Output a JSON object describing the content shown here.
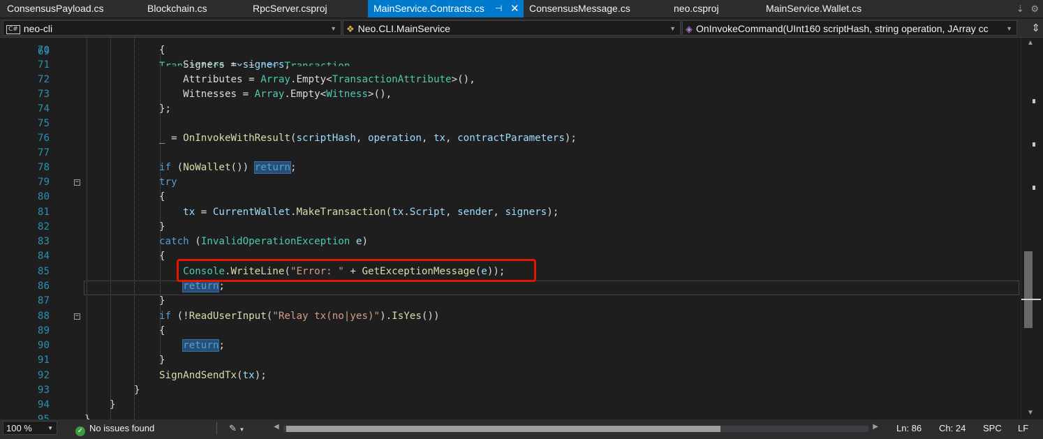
{
  "tabs": [
    {
      "label": "ConsensusPayload.cs"
    },
    {
      "label": "Blockchain.cs"
    },
    {
      "label": "RpcServer.csproj"
    },
    {
      "label": "MainService.Contracts.cs",
      "active": true
    },
    {
      "label": "ConsensusMessage.cs"
    },
    {
      "label": "neo.csproj"
    },
    {
      "label": "MainService.Wallet.cs"
    }
  ],
  "tab_controls": {
    "pin_icon": "⊣",
    "close_icon": "✕",
    "overflow": "⇣",
    "settings": "⚙"
  },
  "navbar": {
    "project": "neo-cli",
    "project_badge": "C#",
    "type": "Neo.CLI.MainService",
    "member": "OnInvokeCommand(UInt160 scriptHash, string operation, JArray cc"
  },
  "editor": {
    "lines": [
      {
        "n": "69",
        "text": "Transaction tx = new Transaction"
      },
      {
        "n": "70",
        "text": "{"
      },
      {
        "n": "71",
        "text": "    Signers = signers,"
      },
      {
        "n": "72",
        "text": "    Attributes = Array.Empty<TransactionAttribute>(),"
      },
      {
        "n": "73",
        "text": "    Witnesses = Array.Empty<Witness>(),"
      },
      {
        "n": "74",
        "text": "};"
      },
      {
        "n": "75",
        "text": ""
      },
      {
        "n": "76",
        "text": "_ = OnInvokeWithResult(scriptHash, operation, tx, contractParameters);"
      },
      {
        "n": "77",
        "text": ""
      },
      {
        "n": "78",
        "text": "if (NoWallet()) return;"
      },
      {
        "n": "79",
        "text": "try"
      },
      {
        "n": "80",
        "text": "{"
      },
      {
        "n": "81",
        "text": "    tx = CurrentWallet.MakeTransaction(tx.Script, sender, signers);"
      },
      {
        "n": "82",
        "text": "}"
      },
      {
        "n": "83",
        "text": "catch (InvalidOperationException e)"
      },
      {
        "n": "84",
        "text": "{"
      },
      {
        "n": "85",
        "text": "    Console.WriteLine(\"Error: \" + GetExceptionMessage(e));"
      },
      {
        "n": "86",
        "text": "    return;"
      },
      {
        "n": "87",
        "text": "}"
      },
      {
        "n": "88",
        "text": "if (!ReadUserInput(\"Relay tx(no|yes)\").IsYes())"
      },
      {
        "n": "89",
        "text": "{"
      },
      {
        "n": "90",
        "text": "    return;"
      },
      {
        "n": "91",
        "text": "}"
      },
      {
        "n": "92",
        "text": "SignAndSendTx(tx);"
      },
      {
        "n": "93",
        "text": "}"
      },
      {
        "n": "94",
        "text": "}"
      },
      {
        "n": "95",
        "text": "}"
      }
    ],
    "fold_marker": "−",
    "current_line": 86
  },
  "statusbar": {
    "zoom": "100 %",
    "issues": "No issues found",
    "ok_icon": "✓",
    "ln": "Ln: 86",
    "ch": "Ch: 24",
    "spc": "SPC",
    "lf": "LF"
  },
  "colors": {
    "keyword": "#569cd6",
    "type": "#4ec9b0",
    "string": "#d69d85",
    "identifier": "#9cdcfe",
    "method": "#dcdcaa",
    "line_number": "#2b91af",
    "accent": "#007acc",
    "highlight_box": "#e51400"
  }
}
